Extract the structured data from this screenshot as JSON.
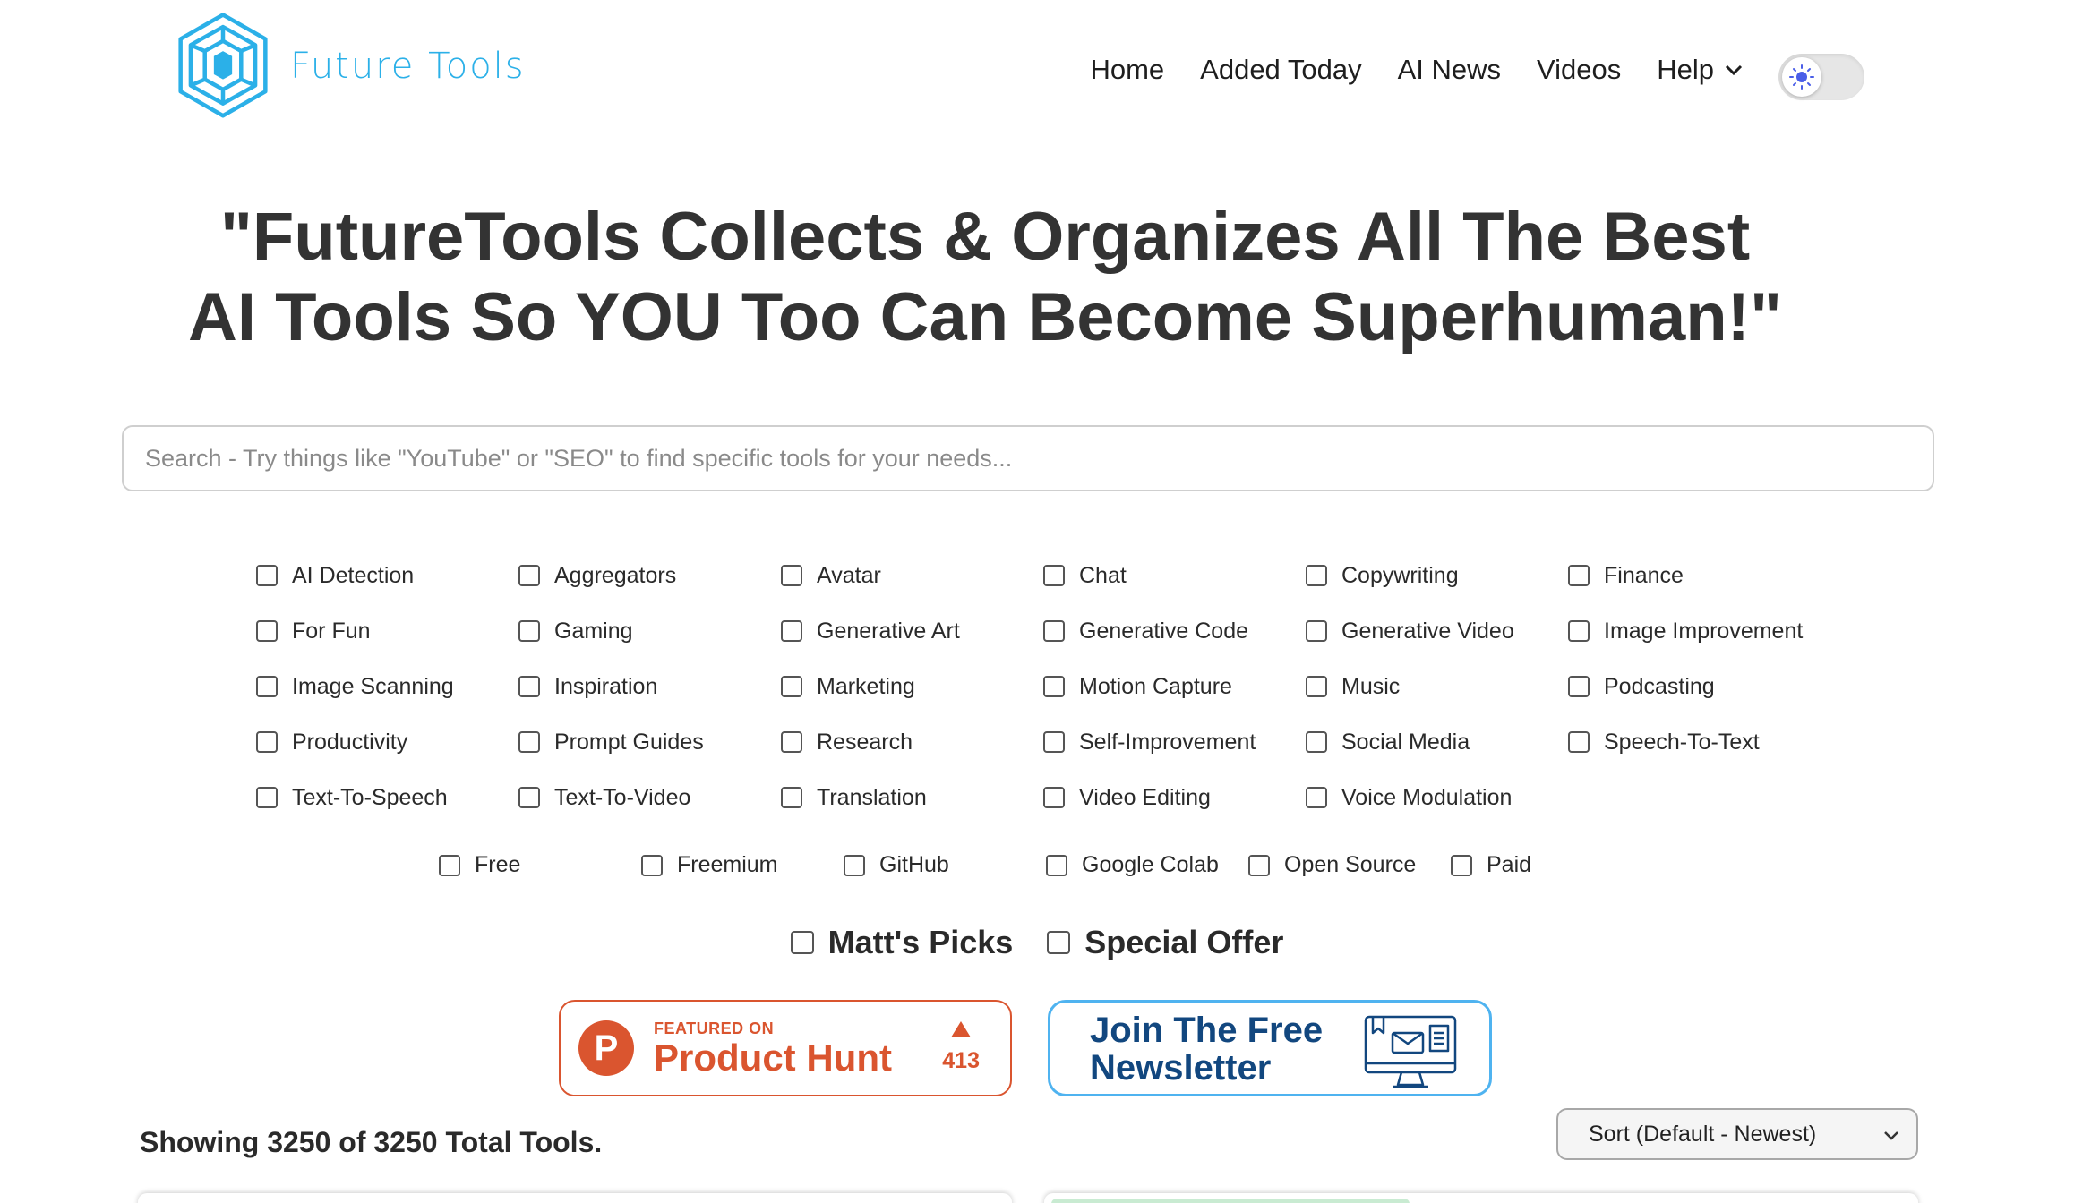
{
  "brand": {
    "name": "Future Tools",
    "color": "#2bb0e8"
  },
  "nav": {
    "items": [
      "Home",
      "Added Today",
      "AI News",
      "Videos"
    ],
    "help_label": "Help"
  },
  "theme_toggle": {
    "state": "light"
  },
  "headline": {
    "line1": "\"FutureTools Collects & Organizes All The Best",
    "line2": "AI Tools So YOU Too Can Become Superhuman!\""
  },
  "search": {
    "placeholder": "Search - Try things like \"YouTube\" or \"SEO\" to find specific tools for your needs...",
    "value": ""
  },
  "categories": [
    "AI Detection",
    "Aggregators",
    "Avatar",
    "Chat",
    "Copywriting",
    "Finance",
    "For Fun",
    "Gaming",
    "Generative Art",
    "Generative Code",
    "Generative Video",
    "Image Improvement",
    "Image Scanning",
    "Inspiration",
    "Marketing",
    "Motion Capture",
    "Music",
    "Podcasting",
    "Productivity",
    "Prompt Guides",
    "Research",
    "Self-Improvement",
    "Social Media",
    "Speech-To-Text",
    "Text-To-Speech",
    "Text-To-Video",
    "Translation",
    "Video Editing",
    "Voice Modulation"
  ],
  "pricing": [
    "Free",
    "Freemium",
    "GitHub",
    "Google Colab",
    "Open Source",
    "Paid"
  ],
  "specials": [
    "Matt's Picks",
    "Special Offer"
  ],
  "product_hunt": {
    "small": "FEATURED ON",
    "big": "Product Hunt",
    "logo_letter": "P",
    "votes": "413",
    "color": "#da552f"
  },
  "newsletter": {
    "line1": "Join The Free",
    "line2": "Newsletter",
    "color": "#12477f",
    "border_color": "#4fb3f0"
  },
  "results": {
    "showing_text": "Showing 3250 of 3250 Total Tools."
  },
  "sort": {
    "selected": "Sort (Default - Newest)"
  }
}
